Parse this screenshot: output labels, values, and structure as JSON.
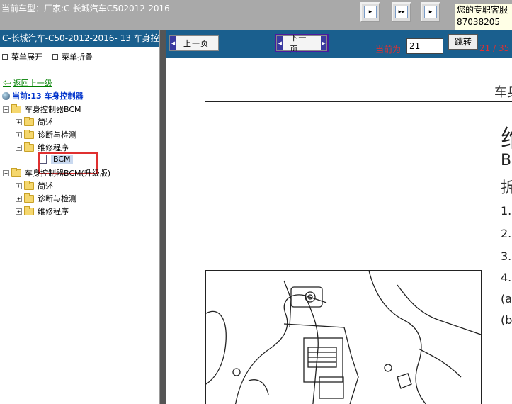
{
  "topbar": {
    "car_model": "当前车型：厂家:C-长城汽车C502012-2016",
    "buttons": [
      {
        "icon": "single-page-icon"
      },
      {
        "icon": "double-page-icon"
      },
      {
        "icon": "fit-page-icon"
      }
    ],
    "support_line1": "您的专职客服",
    "support_line2": "87038205"
  },
  "sidebar": {
    "title": "C-长城汽车-C50-2012-2016- 13 车身控制",
    "expand_label": "菜单展开",
    "collapse_label": "菜单折叠",
    "back_label": "返回上一级",
    "current_label": "当前:13 车身控制器",
    "tree": [
      {
        "label": "车身控制器BCM",
        "level": 0,
        "toggle": "−"
      },
      {
        "label": "简述",
        "level": 1,
        "toggle": "+"
      },
      {
        "label": "诊断与检测",
        "level": 1,
        "toggle": "+"
      },
      {
        "label": "维修程序",
        "level": 1,
        "toggle": "−"
      },
      {
        "label": "BCM",
        "level": 2,
        "selected": true
      },
      {
        "label": "车身控制器BCM(升级版)",
        "level": 0,
        "toggle": "−"
      },
      {
        "label": "简述",
        "level": 1,
        "toggle": "+"
      },
      {
        "label": "诊断与检测",
        "level": 1,
        "toggle": "+"
      },
      {
        "label": "维修程序",
        "level": 1,
        "toggle": "+"
      }
    ]
  },
  "nav": {
    "prev_label": "上一页",
    "next_label": "下一页",
    "current_label": "当前为",
    "page_value": "21",
    "jump_label": "跳转",
    "page_count": "21 / 35 ."
  },
  "content": {
    "heading": "车身",
    "title": "维",
    "subtitle1": "BC",
    "subtitle2": "拆",
    "steps": [
      "1.",
      "2.",
      "3.",
      "4.",
      "(a",
      "(b"
    ]
  },
  "colors": {
    "topbar": "#a9a9a9",
    "navbar": "#1a5f8e",
    "highlight": "#e03030"
  }
}
